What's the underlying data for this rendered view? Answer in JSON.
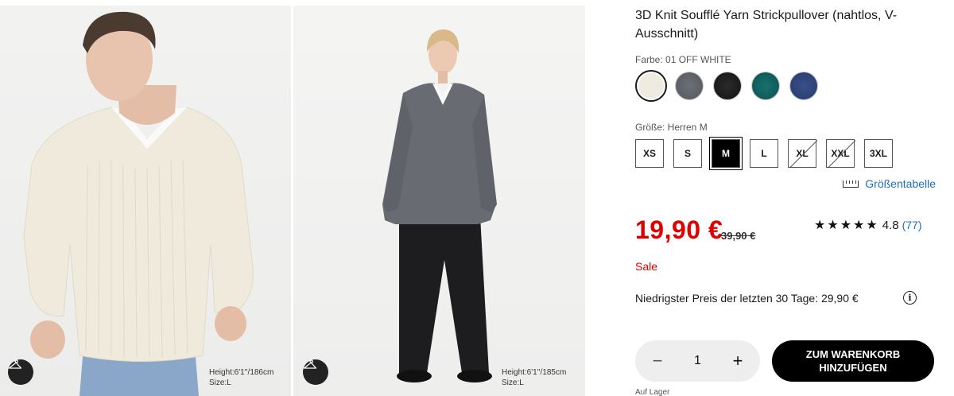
{
  "gallery": {
    "images": [
      {
        "alt": "3D Knit Soufflé Yarn Strickpullover OFF WHITE",
        "model_height": "Height:6'1''/186cm",
        "model_size": "Size:L"
      },
      {
        "alt": "3D Knit Soufflé Yarn Strickpullover GRAY",
        "model_height": "Height:6'1''/185cm",
        "model_size": "Size:L"
      }
    ],
    "hanger_icon": "hanger-icon"
  },
  "product": {
    "title": "3D Knit Soufflé Yarn Strickpullover (nahtlos, V-Ausschnitt)",
    "color_label": "Farbe: 01 OFF WHITE",
    "colors": [
      {
        "name": "OFF WHITE",
        "hex": "#eeebe0",
        "selected": true
      },
      {
        "name": "GRAY",
        "hex": "#5e6066"
      },
      {
        "name": "BLACK",
        "hex": "#1c1c1c"
      },
      {
        "name": "GREEN",
        "hex": "#11605e"
      },
      {
        "name": "NAVY",
        "hex": "#2e4279"
      }
    ],
    "size_label": "Größe: Herren M",
    "sizes": [
      {
        "label": "XS"
      },
      {
        "label": "S"
      },
      {
        "label": "M",
        "selected": true
      },
      {
        "label": "L"
      },
      {
        "label": "XL",
        "unavailable": true
      },
      {
        "label": "XXL",
        "unavailable": true
      },
      {
        "label": "3XL"
      }
    ],
    "size_chart_label": "Größentabelle",
    "price": "19,90 €",
    "old_price": "39,90 €",
    "rating": {
      "stars": "★★★★★",
      "value": "4.8",
      "count": "(77)"
    },
    "sale_label": "Sale",
    "lowest_price_text": "Niedrigster Preis der letzten 30 Tage: 29,90 €",
    "quantity": "1",
    "add_to_cart_label": "ZUM WARENKORB HINZUFÜGEN",
    "stock_label": "Auf Lager",
    "accent_red": "#e00000",
    "link_blue": "#1e6fb8"
  }
}
